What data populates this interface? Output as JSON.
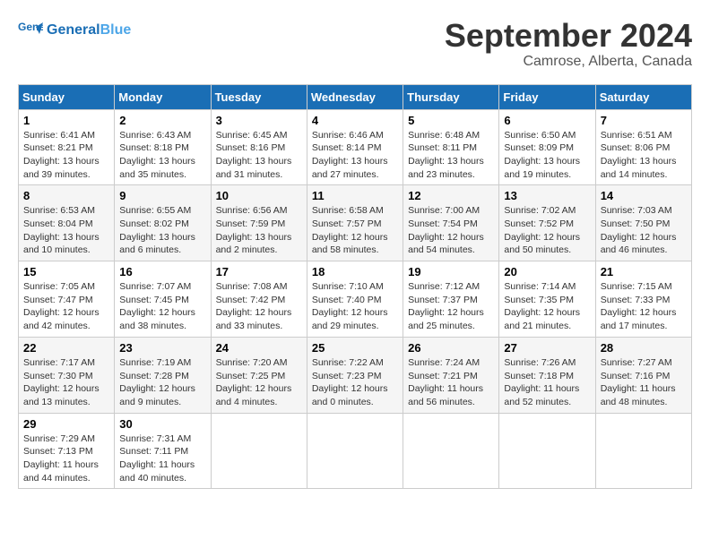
{
  "header": {
    "logo_line1": "General",
    "logo_line2": "Blue",
    "month_title": "September 2024",
    "location": "Camrose, Alberta, Canada"
  },
  "weekdays": [
    "Sunday",
    "Monday",
    "Tuesday",
    "Wednesday",
    "Thursday",
    "Friday",
    "Saturday"
  ],
  "weeks": [
    [
      {
        "day": "1",
        "info": "Sunrise: 6:41 AM\nSunset: 8:21 PM\nDaylight: 13 hours\nand 39 minutes."
      },
      {
        "day": "2",
        "info": "Sunrise: 6:43 AM\nSunset: 8:18 PM\nDaylight: 13 hours\nand 35 minutes."
      },
      {
        "day": "3",
        "info": "Sunrise: 6:45 AM\nSunset: 8:16 PM\nDaylight: 13 hours\nand 31 minutes."
      },
      {
        "day": "4",
        "info": "Sunrise: 6:46 AM\nSunset: 8:14 PM\nDaylight: 13 hours\nand 27 minutes."
      },
      {
        "day": "5",
        "info": "Sunrise: 6:48 AM\nSunset: 8:11 PM\nDaylight: 13 hours\nand 23 minutes."
      },
      {
        "day": "6",
        "info": "Sunrise: 6:50 AM\nSunset: 8:09 PM\nDaylight: 13 hours\nand 19 minutes."
      },
      {
        "day": "7",
        "info": "Sunrise: 6:51 AM\nSunset: 8:06 PM\nDaylight: 13 hours\nand 14 minutes."
      }
    ],
    [
      {
        "day": "8",
        "info": "Sunrise: 6:53 AM\nSunset: 8:04 PM\nDaylight: 13 hours\nand 10 minutes."
      },
      {
        "day": "9",
        "info": "Sunrise: 6:55 AM\nSunset: 8:02 PM\nDaylight: 13 hours\nand 6 minutes."
      },
      {
        "day": "10",
        "info": "Sunrise: 6:56 AM\nSunset: 7:59 PM\nDaylight: 13 hours\nand 2 minutes."
      },
      {
        "day": "11",
        "info": "Sunrise: 6:58 AM\nSunset: 7:57 PM\nDaylight: 12 hours\nand 58 minutes."
      },
      {
        "day": "12",
        "info": "Sunrise: 7:00 AM\nSunset: 7:54 PM\nDaylight: 12 hours\nand 54 minutes."
      },
      {
        "day": "13",
        "info": "Sunrise: 7:02 AM\nSunset: 7:52 PM\nDaylight: 12 hours\nand 50 minutes."
      },
      {
        "day": "14",
        "info": "Sunrise: 7:03 AM\nSunset: 7:50 PM\nDaylight: 12 hours\nand 46 minutes."
      }
    ],
    [
      {
        "day": "15",
        "info": "Sunrise: 7:05 AM\nSunset: 7:47 PM\nDaylight: 12 hours\nand 42 minutes."
      },
      {
        "day": "16",
        "info": "Sunrise: 7:07 AM\nSunset: 7:45 PM\nDaylight: 12 hours\nand 38 minutes."
      },
      {
        "day": "17",
        "info": "Sunrise: 7:08 AM\nSunset: 7:42 PM\nDaylight: 12 hours\nand 33 minutes."
      },
      {
        "day": "18",
        "info": "Sunrise: 7:10 AM\nSunset: 7:40 PM\nDaylight: 12 hours\nand 29 minutes."
      },
      {
        "day": "19",
        "info": "Sunrise: 7:12 AM\nSunset: 7:37 PM\nDaylight: 12 hours\nand 25 minutes."
      },
      {
        "day": "20",
        "info": "Sunrise: 7:14 AM\nSunset: 7:35 PM\nDaylight: 12 hours\nand 21 minutes."
      },
      {
        "day": "21",
        "info": "Sunrise: 7:15 AM\nSunset: 7:33 PM\nDaylight: 12 hours\nand 17 minutes."
      }
    ],
    [
      {
        "day": "22",
        "info": "Sunrise: 7:17 AM\nSunset: 7:30 PM\nDaylight: 12 hours\nand 13 minutes."
      },
      {
        "day": "23",
        "info": "Sunrise: 7:19 AM\nSunset: 7:28 PM\nDaylight: 12 hours\nand 9 minutes."
      },
      {
        "day": "24",
        "info": "Sunrise: 7:20 AM\nSunset: 7:25 PM\nDaylight: 12 hours\nand 4 minutes."
      },
      {
        "day": "25",
        "info": "Sunrise: 7:22 AM\nSunset: 7:23 PM\nDaylight: 12 hours\nand 0 minutes."
      },
      {
        "day": "26",
        "info": "Sunrise: 7:24 AM\nSunset: 7:21 PM\nDaylight: 11 hours\nand 56 minutes."
      },
      {
        "day": "27",
        "info": "Sunrise: 7:26 AM\nSunset: 7:18 PM\nDaylight: 11 hours\nand 52 minutes."
      },
      {
        "day": "28",
        "info": "Sunrise: 7:27 AM\nSunset: 7:16 PM\nDaylight: 11 hours\nand 48 minutes."
      }
    ],
    [
      {
        "day": "29",
        "info": "Sunrise: 7:29 AM\nSunset: 7:13 PM\nDaylight: 11 hours\nand 44 minutes."
      },
      {
        "day": "30",
        "info": "Sunrise: 7:31 AM\nSunset: 7:11 PM\nDaylight: 11 hours\nand 40 minutes."
      },
      {
        "day": "",
        "info": ""
      },
      {
        "day": "",
        "info": ""
      },
      {
        "day": "",
        "info": ""
      },
      {
        "day": "",
        "info": ""
      },
      {
        "day": "",
        "info": ""
      }
    ]
  ]
}
